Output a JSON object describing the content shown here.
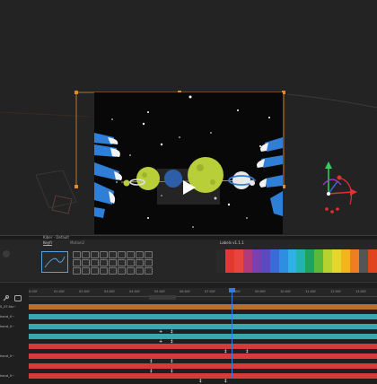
{
  "panels": {
    "main_title": "Kiber - Default",
    "keyframe_tab": "Keyfr",
    "second_tab": "Motion2",
    "labels_title": "Labels v1.1.1"
  },
  "timeline": {
    "timecodes": [
      "0:00f",
      "01:00f",
      "02:00f",
      "03:00f",
      "04:00f",
      "05:00f",
      "06:00f",
      "07:00f",
      "08:00f",
      "09:00f",
      "10:00f",
      "11:00f",
      "12:00f",
      "13:00f",
      "14:00f"
    ],
    "layers": [
      {
        "label": "S_07-Nu~",
        "color": "#b86e2a"
      },
      {
        "label": "hand_0~",
        "color": "#3aa6b1"
      },
      {
        "label": "hand_0~",
        "color": "#3aa6b1"
      },
      {
        "label": "",
        "color": "#3aa6b1"
      },
      {
        "label": "",
        "color": "#d63a3a"
      },
      {
        "label": "hand_0~",
        "color": "#d63a3a"
      },
      {
        "label": "",
        "color": "#d63a3a"
      },
      {
        "label": "hand_0~",
        "color": "#d63a3a"
      }
    ]
  },
  "label_colors": [
    "#2a2a2a",
    "#e23a2e",
    "#e8463c",
    "#b03a7c",
    "#7a3fb0",
    "#5c4ac0",
    "#3c6ad8",
    "#2e8ee0",
    "#2fb1e6",
    "#22b3b0",
    "#1fa25c",
    "#5cb83a",
    "#b6d22e",
    "#e6d52a",
    "#f2b51c",
    "#ef7d22",
    "#555555",
    "#e0431f"
  ],
  "colors": {
    "accent": "#e08a2c",
    "playhead": "#2e7de0"
  }
}
